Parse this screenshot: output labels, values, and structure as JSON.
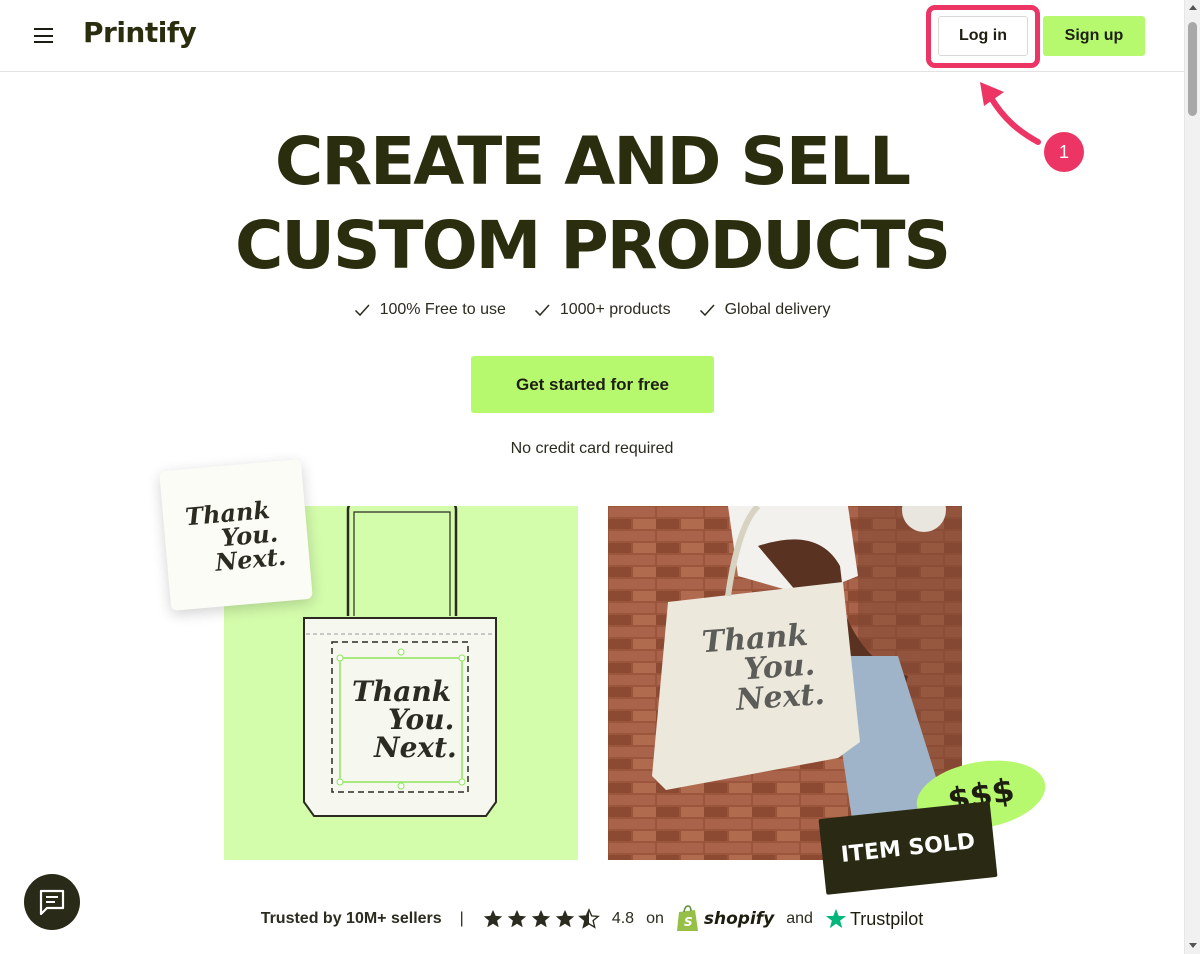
{
  "header": {
    "logo_text": "Printify",
    "login_label": "Log in",
    "signup_label": "Sign up"
  },
  "annotation": {
    "step_number": "1",
    "highlight_color": "#ec3564"
  },
  "hero": {
    "headline_line1": "CREATE AND SELL",
    "headline_line2": "CUSTOM PRODUCTS",
    "features": [
      "100% Free to use",
      "1000+ products",
      "Global delivery"
    ],
    "cta_label": "Get started for free",
    "subtext": "No credit card required"
  },
  "artwork": {
    "line1": "Thank",
    "line2": "You.",
    "line3": "Next."
  },
  "badges": {
    "sold": "ITEM SOLD",
    "money": "$$$"
  },
  "trust": {
    "sellers": "Trusted by 10M+ sellers",
    "separator": "|",
    "rating": "4.8",
    "on": "on",
    "shopify": "shopify",
    "and": "and",
    "trustpilot": "Trustpilot"
  },
  "colors": {
    "accent_green": "#b6f86e",
    "brand_dark": "#2b2e0e",
    "trustpilot_green": "#00b67a",
    "shopify_green": "#95bf47"
  }
}
